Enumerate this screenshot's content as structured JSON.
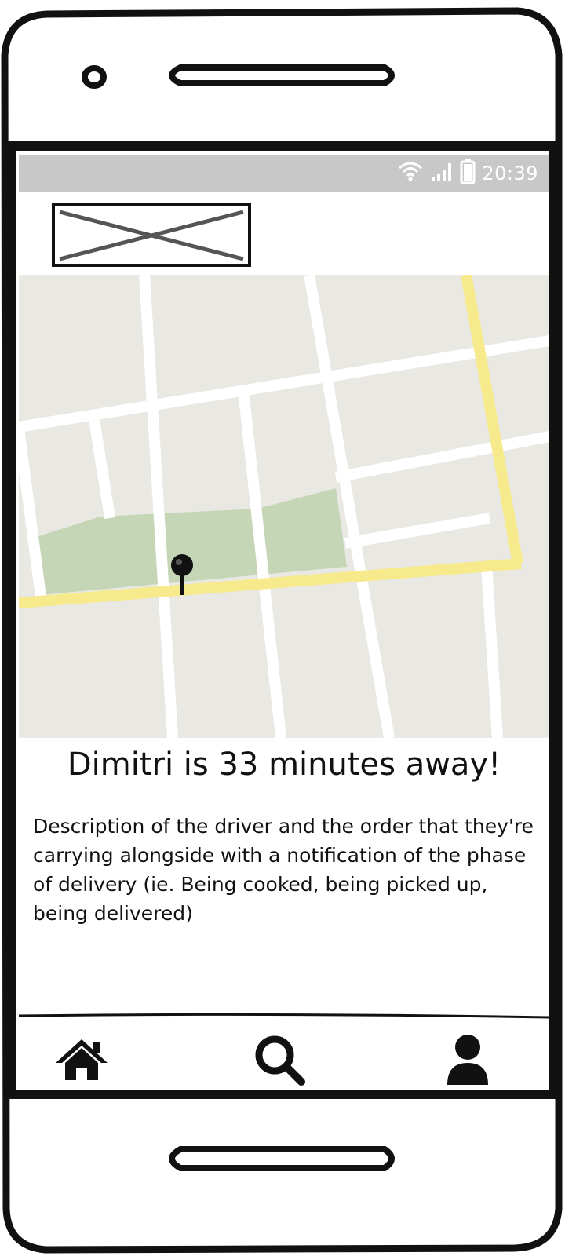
{
  "status_bar": {
    "time": "20:39",
    "icons": [
      "wifi-icon",
      "signal-icon",
      "battery-icon"
    ]
  },
  "header": {
    "logo": "image-placeholder"
  },
  "map": {
    "pin_icon": "map-pin-icon",
    "colors": {
      "land": "#e9e8e3",
      "road": "#ffffff",
      "main_road": "#f7ea8c",
      "park": "#c5d6b6"
    }
  },
  "delivery": {
    "headline": "Dimitri is 33 minutes away!",
    "description": "Description of the driver and the order that they're carrying alongside with a notification of the phase of delivery (ie. Being cooked, being picked up, being delivered)"
  },
  "bottom_nav": {
    "items": [
      {
        "icon": "home-icon"
      },
      {
        "icon": "search-icon"
      },
      {
        "icon": "user-icon"
      }
    ]
  }
}
